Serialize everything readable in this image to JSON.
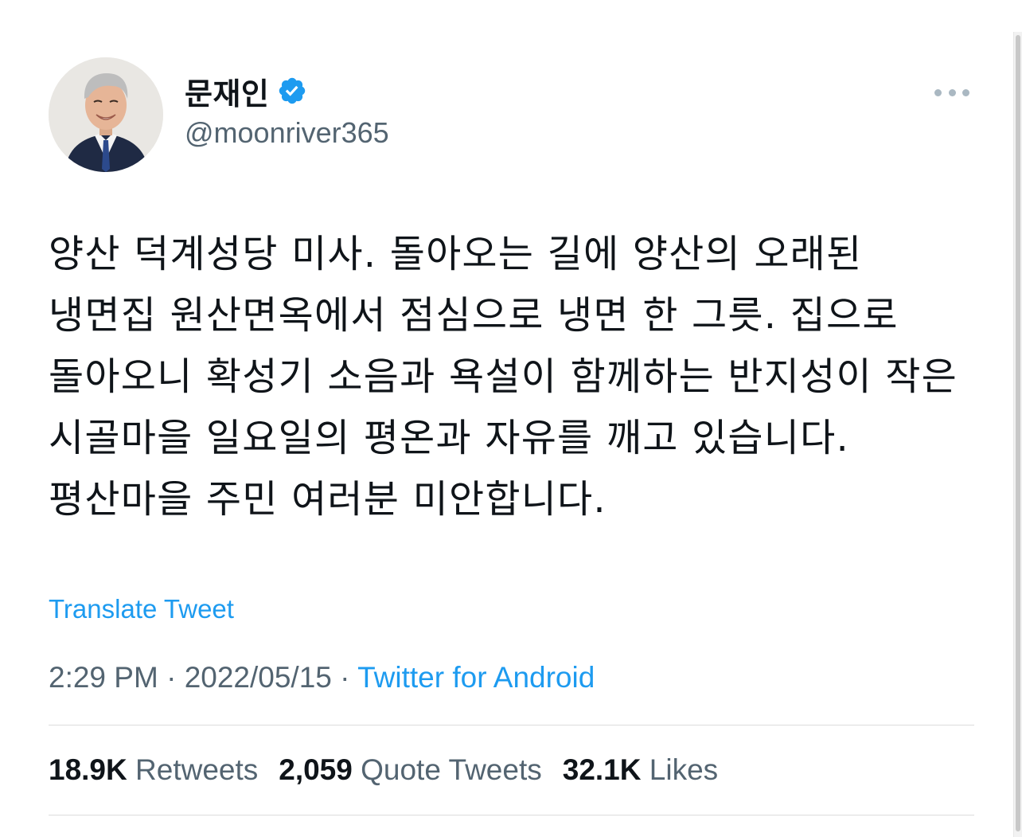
{
  "author": {
    "display_name": "문재인",
    "handle": "@moonriver365",
    "verified": true,
    "avatar_icon": "profile-photo",
    "verified_icon": "verified-badge-icon"
  },
  "tweet": {
    "text": "양산 덕계성당 미사. 돌아오는 길에 양산의 오래된 냉면집 원산면옥에서 점심으로 냉면 한 그릇. 집으로 돌아오니 확성기 소음과 욕설이 함께하는 반지성이 작은 시골마을 일요일의 평온과 자유를 깨고 있습니다. 평산마을 주민 여러분 미안합니다.",
    "translate_label": "Translate Tweet",
    "time": "2:29 PM",
    "date": "2022/05/15",
    "source": "Twitter for Android",
    "separator": "·"
  },
  "stats": {
    "retweets_count": "18.9K",
    "retweets_label": "Retweets",
    "quotes_count": "2,059",
    "quotes_label": "Quote Tweets",
    "likes_count": "32.1K",
    "likes_label": "Likes"
  },
  "colors": {
    "link": "#1d9bf0",
    "secondary_text": "#536471",
    "primary_text": "#0f1419"
  }
}
